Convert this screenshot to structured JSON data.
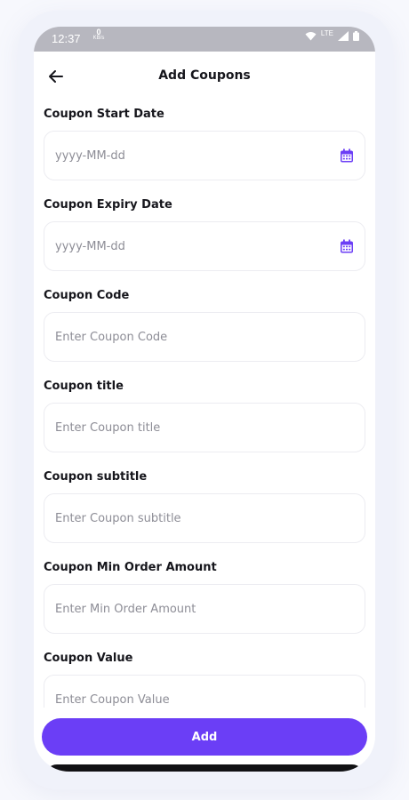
{
  "status_bar": {
    "time": "12:37",
    "net_speed": "0",
    "net_unit": "KB/s",
    "network_type": "LTE"
  },
  "header": {
    "title": "Add Coupons",
    "back_icon": "arrow-left-icon"
  },
  "form": {
    "fields": [
      {
        "label": "Coupon Start Date",
        "placeholder": "yyyy-MM-dd",
        "icon": "calendar-icon"
      },
      {
        "label": "Coupon Expiry Date",
        "placeholder": "yyyy-MM-dd",
        "icon": "calendar-icon"
      },
      {
        "label": "Coupon Code",
        "placeholder": "Enter Coupon Code"
      },
      {
        "label": "Coupon title",
        "placeholder": "Enter Coupon title"
      },
      {
        "label": "Coupon subtitle",
        "placeholder": "Enter Coupon subtitle"
      },
      {
        "label": "Coupon Min Order Amount",
        "placeholder": "Enter Min Order Amount"
      },
      {
        "label": "Coupon Value",
        "placeholder": "Enter Coupon Value"
      }
    ]
  },
  "actions": {
    "submit_label": "Add"
  },
  "colors": {
    "accent": "#6b3ef6",
    "status_bar_bg": "#b7b7bf",
    "label_text": "#16161c",
    "placeholder_text": "#8d8d96",
    "field_border": "#ececf1"
  }
}
